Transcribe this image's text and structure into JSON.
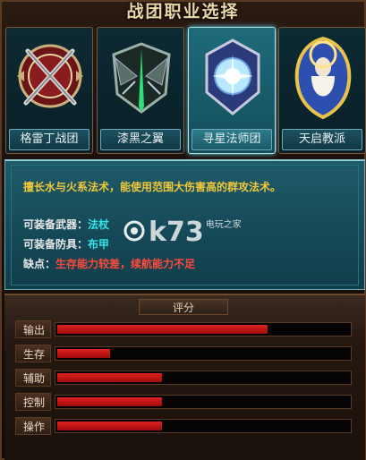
{
  "title": "战团职业选择",
  "classes": [
    {
      "label": "格雷丁战团",
      "icon": "crossed-swords-emblem-icon",
      "selected": false
    },
    {
      "label": "漆黑之翼",
      "icon": "winged-sword-emblem-icon",
      "selected": false
    },
    {
      "label": "寻星法师团",
      "icon": "star-orb-emblem-icon",
      "selected": true
    },
    {
      "label": "天启教派",
      "icon": "priestess-emblem-icon",
      "selected": false
    }
  ],
  "description": {
    "main": "擅长水与火系法术，能使用范围大伤害高的群攻法术。",
    "weapon_label": "可装备武器：",
    "weapon_value": "法杖",
    "armor_label": "可装备防具：",
    "armor_value": "布甲",
    "weakness_label": "缺点：",
    "weakness_value": "生存能力较差，续航能力不足"
  },
  "watermark": {
    "text": "k73",
    "sub": "电玩之家"
  },
  "rating": {
    "header": "评分",
    "stats": [
      {
        "name": "输出",
        "value": 0.72
      },
      {
        "name": "生存",
        "value": 0.18
      },
      {
        "name": "辅助",
        "value": 0.36
      },
      {
        "name": "控制",
        "value": 0.36
      },
      {
        "name": "操作",
        "value": 0.36
      }
    ]
  },
  "colors": {
    "accent_gold": "#f0c83a",
    "accent_cyan": "#35e2e6",
    "accent_red": "#ff4a3a",
    "bar_red": "#e02020"
  }
}
